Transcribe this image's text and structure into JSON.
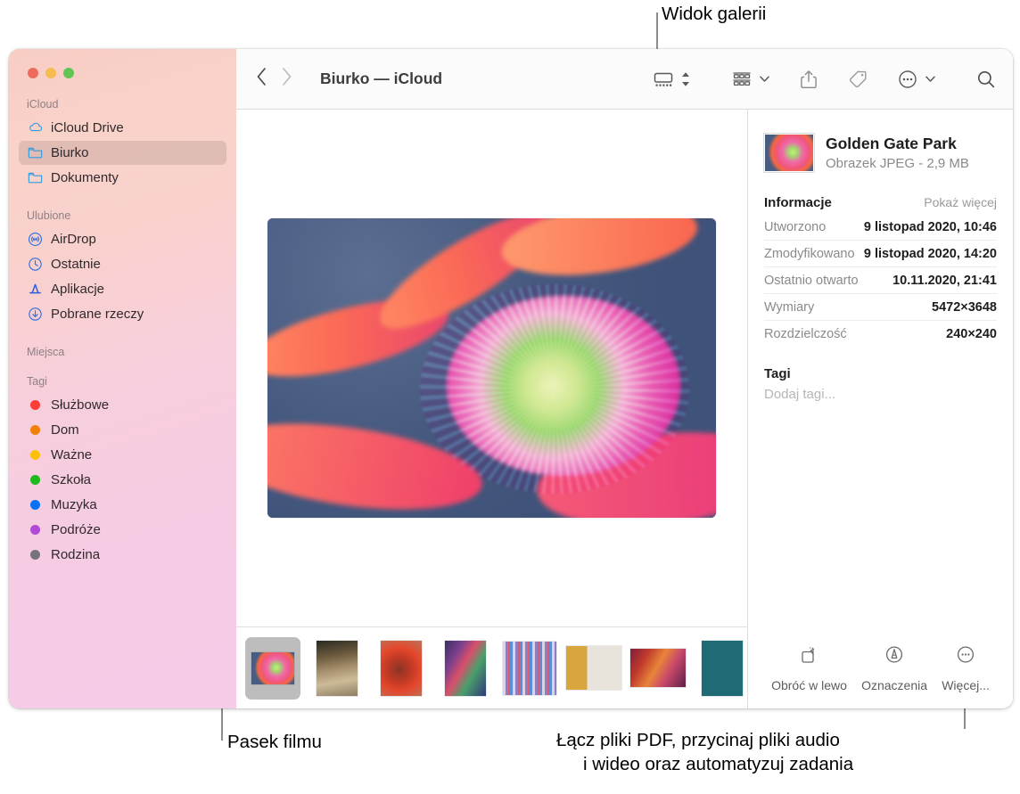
{
  "annotations": [
    {
      "id": "gallery-view",
      "text": "Widok galerii"
    },
    {
      "id": "film-strip",
      "text": "Pasek filmu"
    },
    {
      "id": "more-tools-line1",
      "text": "Łącz pliki PDF, przycinaj pliki audio"
    },
    {
      "id": "more-tools-line2",
      "text": "i wideo oraz automatyzuj zadania"
    }
  ],
  "window": {
    "traffic_lights": [
      {
        "name": "close",
        "color": "#ee6a5f"
      },
      {
        "name": "minimize",
        "color": "#f5bd4f"
      },
      {
        "name": "zoom",
        "color": "#61c554"
      }
    ]
  },
  "toolbar": {
    "back_icon": "chevron-left-icon",
    "forward_icon": "chevron-right-icon",
    "title": "Biurko — iCloud",
    "buttons": [
      {
        "name": "gallery-view-button",
        "icon": "gallery-view-icon"
      },
      {
        "name": "view-options-stepper",
        "icon": "chevron-up-down-icon"
      },
      {
        "name": "group-by-button",
        "icon": "group-grid-icon"
      },
      {
        "name": "group-by-chevron",
        "icon": "chevron-down-icon"
      },
      {
        "name": "share-button",
        "icon": "share-icon"
      },
      {
        "name": "tag-button",
        "icon": "tag-icon"
      },
      {
        "name": "more-actions-button",
        "icon": "ellipsis-circle-icon"
      },
      {
        "name": "more-actions-chevron",
        "icon": "chevron-down-icon"
      },
      {
        "name": "search-button",
        "icon": "search-icon"
      }
    ]
  },
  "sidebar": {
    "sections": [
      {
        "header": "iCloud",
        "items": [
          {
            "label": "iCloud Drive",
            "icon": "cloud-icon",
            "selected": false
          },
          {
            "label": "Biurko",
            "icon": "folder-icon",
            "selected": true
          },
          {
            "label": "Dokumenty",
            "icon": "folder-icon",
            "selected": false
          }
        ]
      },
      {
        "header": "Ulubione",
        "items": [
          {
            "label": "AirDrop",
            "icon": "airdrop-icon",
            "selected": false
          },
          {
            "label": "Ostatnie",
            "icon": "clock-icon",
            "selected": false
          },
          {
            "label": "Aplikacje",
            "icon": "app-store-icon",
            "selected": false
          },
          {
            "label": "Pobrane rzeczy",
            "icon": "download-icon",
            "selected": false
          }
        ]
      },
      {
        "header": "Miejsca",
        "items": []
      },
      {
        "header": "Tagi",
        "items": [
          {
            "label": "Służbowe",
            "icon": "dot-icon",
            "color": "#fc3d39"
          },
          {
            "label": "Dom",
            "icon": "dot-icon",
            "color": "#f0820c"
          },
          {
            "label": "Ważne",
            "icon": "dot-icon",
            "color": "#fcc00c"
          },
          {
            "label": "Szkoła",
            "icon": "dot-icon",
            "color": "#1db91d"
          },
          {
            "label": "Muzyka",
            "icon": "dot-icon",
            "color": "#0a72f5"
          },
          {
            "label": "Podróże",
            "icon": "dot-icon",
            "color": "#b24ad6"
          },
          {
            "label": "Rodzina",
            "icon": "dot-icon",
            "color": "#77737a"
          }
        ]
      }
    ]
  },
  "preview": {
    "image_name": "golden-gate-park-flower-macro"
  },
  "filmstrip": {
    "items": [
      {
        "name": "thumb-flower-macro",
        "selected": true
      },
      {
        "name": "thumb-forest-path",
        "selected": false
      },
      {
        "name": "thumb-red-hand",
        "selected": false
      },
      {
        "name": "thumb-portrait-neon",
        "selected": false
      },
      {
        "name": "thumb-stripes-person",
        "selected": false
      },
      {
        "name": "thumb-louisa-parris",
        "selected": false
      },
      {
        "name": "thumb-gradient-beam",
        "selected": false
      },
      {
        "name": "thumb-marketing-plan",
        "selected": false
      }
    ]
  },
  "info_panel": {
    "file_name": "Golden Gate Park",
    "file_subtitle": "Obrazek JPEG - 2,9 MB",
    "section_title": "Informacje",
    "show_more": "Pokaż więcej",
    "rows": [
      {
        "key": "Utworzono",
        "value": "9 listopad 2020, 10:46"
      },
      {
        "key": "Zmodyfikowano",
        "value": "9 listopad 2020, 14:20"
      },
      {
        "key": "Ostatnio otwarto",
        "value": "10.11.2020, 21:41"
      },
      {
        "key": "Wymiary",
        "value": "5472×3648"
      },
      {
        "key": "Rozdzielczość",
        "value": "240×240"
      }
    ],
    "tags_title": "Tagi",
    "tags_placeholder": "Dodaj tagi...",
    "actions": [
      {
        "label": "Obróć w lewo",
        "icon": "rotate-left-icon"
      },
      {
        "label": "Oznaczenia",
        "icon": "markup-icon"
      },
      {
        "label": "Więcej...",
        "icon": "ellipsis-circle-icon"
      }
    ]
  }
}
